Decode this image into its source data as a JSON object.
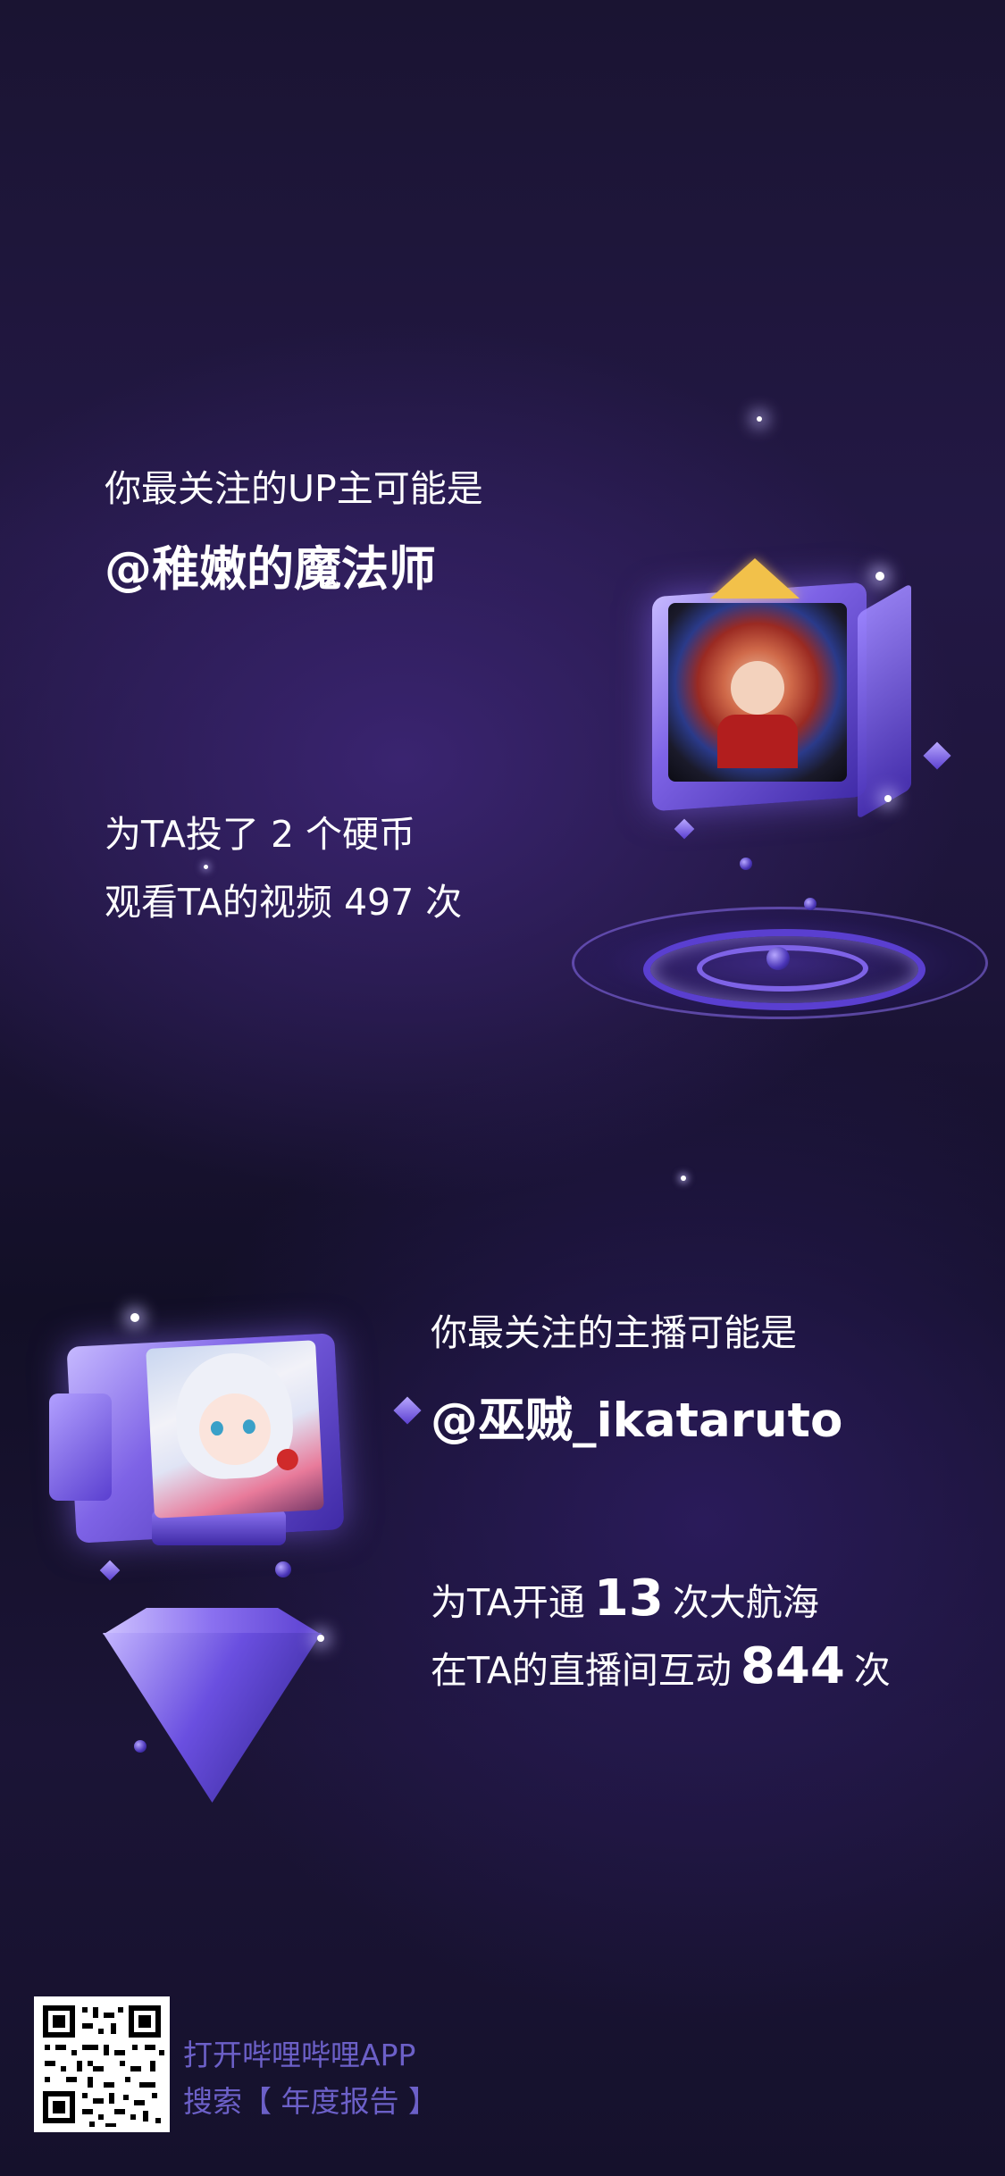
{
  "section1": {
    "label": "你最关注的UP主可能是",
    "handle": "@稚嫩的魔法师",
    "stat1": "为TA投了 2 个硬币",
    "stat2": "观看TA的视频 497 次"
  },
  "section2": {
    "label": "你最关注的主播可能是",
    "handle": "@巫贼_ikataruto",
    "stat1_prefix": "为TA开通",
    "stat1_value": "13",
    "stat1_suffix": "次大航海",
    "stat2_prefix": "在TA的直播间互动",
    "stat2_value": "844",
    "stat2_suffix": "次"
  },
  "footer": {
    "line1": "打开哔哩哔哩APP",
    "line2": "搜索【 年度报告 】"
  },
  "colors": {
    "accent": "#7e63e6",
    "footer_text": "#6c60c8",
    "background_dark": "#15112c"
  },
  "icons": {
    "crown": "crown-icon",
    "qr": "qr-code-icon"
  }
}
